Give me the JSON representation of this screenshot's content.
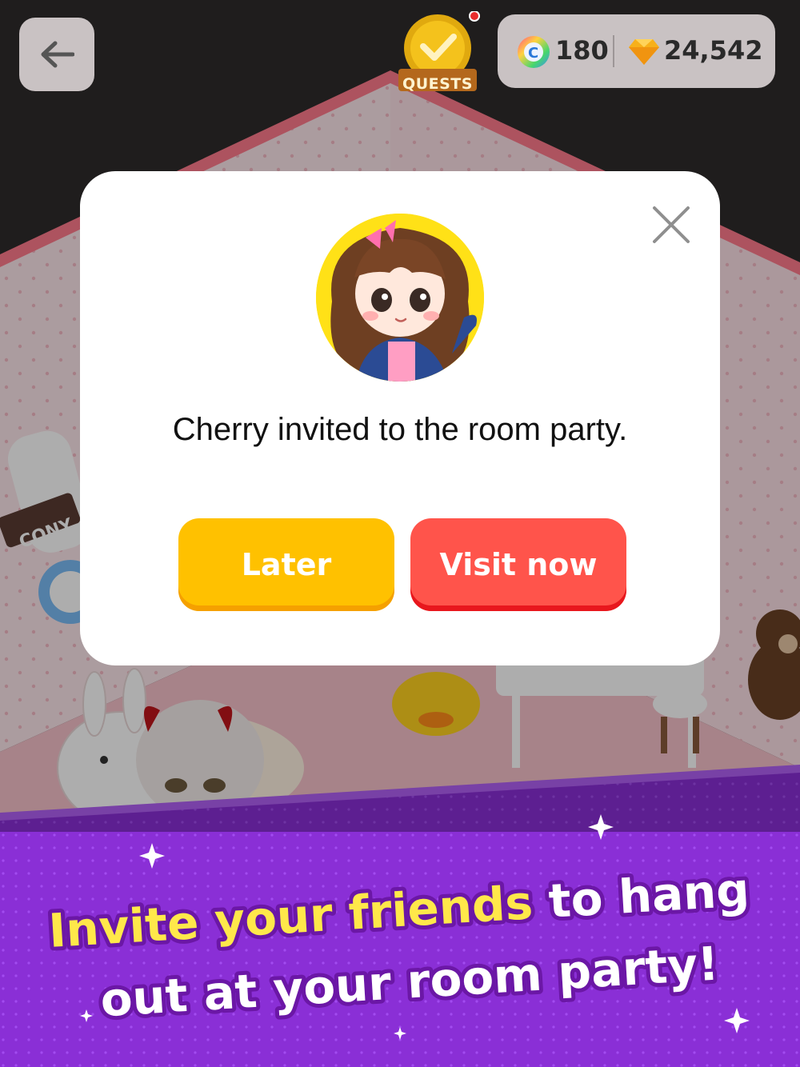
{
  "topbar": {
    "back_icon": "arrow-left-icon",
    "quests_label": "QUESTS",
    "coins": "180",
    "gems": "24,542",
    "colors": {
      "bar": "#c9c2c3",
      "quest_gold": "#f4c21c"
    }
  },
  "room": {
    "sign_text": "CONY"
  },
  "invite_dialog": {
    "message": "Cherry invited to the room party.",
    "later_label": "Later",
    "visit_label": "Visit now",
    "close_icon": "close-icon",
    "colors": {
      "later": "#ffc100",
      "visit": "#ff544b"
    }
  },
  "promo": {
    "line1_highlight": "Invite your friends",
    "line1_rest": " to hang",
    "line2": "out at your room party!",
    "colors": {
      "background": "#8a2fd6",
      "highlight": "#ffe84a"
    }
  }
}
